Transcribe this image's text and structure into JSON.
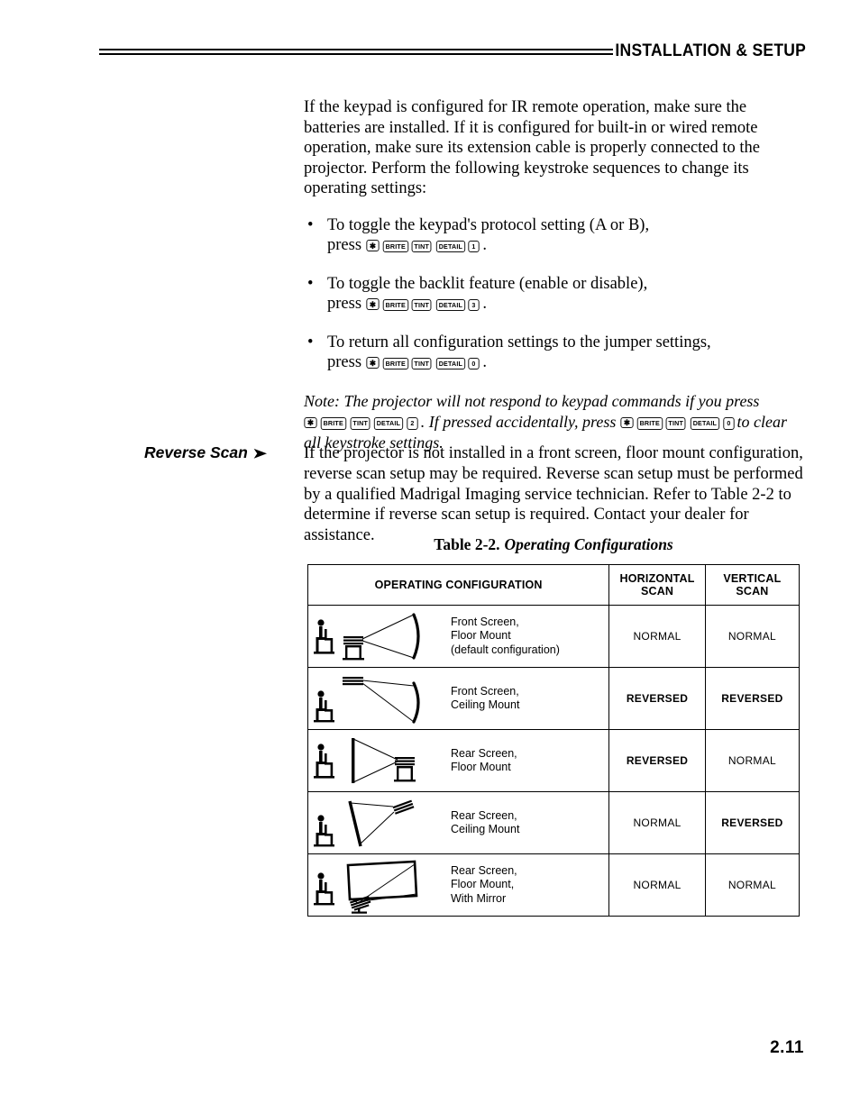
{
  "header": {
    "title": "INSTALLATION & SETUP",
    "rule_icon": "double-rule-divider"
  },
  "intro": {
    "paragraph": "If the keypad is configured for IR remote operation, make sure the batteries are installed. If it is configured for built-in or wired remote operation, make sure its extension cable is properly connected to the projector. Perform the following keystroke sequences to change its operating settings:"
  },
  "bullets": [
    {
      "bullet": "•",
      "line1": "To toggle the keypad's protocol setting (A or B),",
      "press_label": "press",
      "keys": [
        "✱",
        "BRITE",
        "TINT",
        "DETAIL",
        "1"
      ],
      "trailing": "."
    },
    {
      "bullet": "•",
      "line1": "To toggle the backlit feature (enable or disable),",
      "press_label": "press",
      "keys": [
        "✱",
        "BRITE",
        "TINT",
        "DETAIL",
        "3"
      ],
      "trailing": "."
    },
    {
      "bullet": "•",
      "line1": "To return all configuration settings to the jumper settings,",
      "press_label": "press",
      "keys": [
        "✱",
        "BRITE",
        "TINT",
        "DETAIL",
        "0"
      ],
      "trailing": "."
    }
  ],
  "note": {
    "text_1": "Note: The projector will not respond to keypad commands if you press",
    "keys_1": [
      "✱",
      "BRITE",
      "TINT",
      "DETAIL",
      "2"
    ],
    "text_2": ". If pressed accidentally, press",
    "keys_2": [
      "✱",
      "BRITE",
      "TINT",
      "DETAIL",
      "0"
    ],
    "text_3": "to clear all keystroke settings."
  },
  "section": {
    "heading": "Reverse Scan",
    "arrow": "➤",
    "body": "If the projector is not installed in a front screen, floor mount configuration, reverse scan setup may be required. Reverse scan setup must be performed by a qualified Madrigal Imaging service technician. Refer to Table 2-2 to determine if reverse scan setup is required. Contact your dealer for assistance."
  },
  "table": {
    "caption_number": "Table 2-2.",
    "caption_title": "Operating Configurations",
    "columns": [
      "OPERATING CONFIGURATION",
      "HORIZONTAL SCAN",
      "VERTICAL SCAN"
    ],
    "column_lines": [
      [
        "OPERATING CONFIGURATION"
      ],
      [
        "HORIZONTAL",
        "SCAN"
      ],
      [
        "VERTICAL",
        "SCAN"
      ]
    ],
    "rows": [
      {
        "diagram": "front-screen-floor-mount-diagram",
        "label_lines": [
          "Front Screen,",
          "Floor Mount",
          "(default configuration)"
        ],
        "horizontal_scan": "NORMAL",
        "vertical_scan": "NORMAL",
        "horizontal_bold": false,
        "vertical_bold": false
      },
      {
        "diagram": "front-screen-ceiling-mount-diagram",
        "label_lines": [
          "Front Screen,",
          "Ceiling Mount"
        ],
        "horizontal_scan": "REVERSED",
        "vertical_scan": "REVERSED",
        "horizontal_bold": true,
        "vertical_bold": true
      },
      {
        "diagram": "rear-screen-floor-mount-diagram",
        "label_lines": [
          "Rear Screen,",
          "Floor Mount"
        ],
        "horizontal_scan": "REVERSED",
        "vertical_scan": "NORMAL",
        "horizontal_bold": true,
        "vertical_bold": false
      },
      {
        "diagram": "rear-screen-ceiling-mount-diagram",
        "label_lines": [
          "Rear Screen,",
          "Ceiling Mount"
        ],
        "horizontal_scan": "NORMAL",
        "vertical_scan": "REVERSED",
        "horizontal_bold": false,
        "vertical_bold": true
      },
      {
        "diagram": "rear-screen-floor-mount-with-mirror-diagram",
        "label_lines": [
          "Rear Screen,",
          "Floor Mount,",
          "With Mirror"
        ],
        "horizontal_scan": "NORMAL",
        "vertical_scan": "NORMAL",
        "horizontal_bold": false,
        "vertical_bold": false
      }
    ]
  },
  "footer": {
    "page_number": "2.11"
  }
}
